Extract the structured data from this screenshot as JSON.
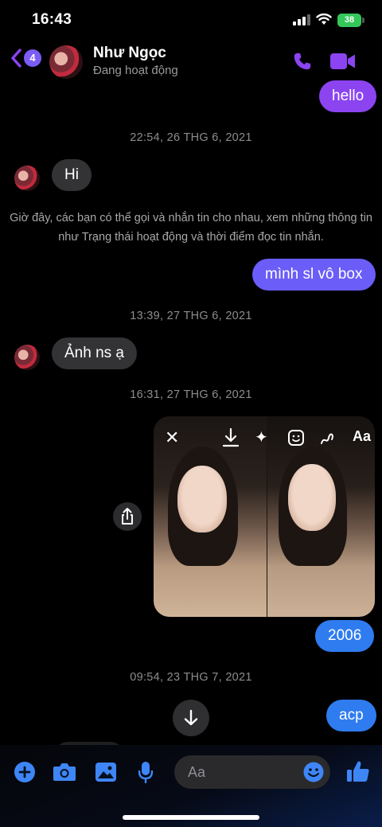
{
  "status_bar": {
    "time": "16:43",
    "battery": "38"
  },
  "header": {
    "back_badge": "4",
    "contact_name": "Như Ngọc",
    "contact_status": "Đang hoạt động"
  },
  "messages": {
    "hello": "hello",
    "ts1": "22:54, 26 THG 6, 2021",
    "hi": "Hi",
    "notice": "Giờ đây, các bạn có thể gọi và nhắn tin cho nhau, xem những thông tin như Trạng thái hoạt động và thời điểm đọc tin nhắn.",
    "box": "mình sl vô box",
    "ts2": "13:39, 27 THG 6, 2021",
    "anh": "Ảnh ns ạ",
    "ts3": "16:31, 27 THG 6, 2021",
    "photo_tool_text": "Aa",
    "year": "2006",
    "ts4": "09:54, 23 THG 7, 2021",
    "acp": "acp"
  },
  "composer": {
    "placeholder": "Aa"
  },
  "colors": {
    "accent": "#8b44f0",
    "sent_blue": "#2f7cf0",
    "received": "#333335"
  },
  "icons": [
    "back-chevron-icon",
    "phone-icon",
    "video-camera-icon",
    "share-icon",
    "arrow-down-icon",
    "plus-icon",
    "camera-icon",
    "image-icon",
    "microphone-icon",
    "smile-emoji-icon",
    "thumbs-up-icon"
  ]
}
